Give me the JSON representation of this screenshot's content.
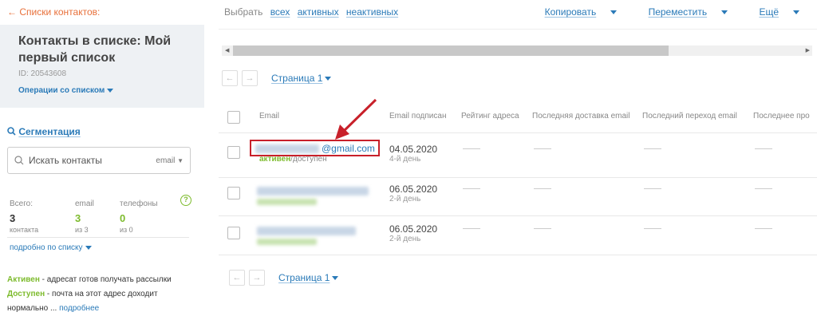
{
  "sidebar": {
    "back_link": "← Списки контактов:",
    "list_title": "Контакты в списке: Мой первый список",
    "list_id": "ID: 20543608",
    "list_ops": "Операции со списком",
    "segmentation": "Сегментация",
    "search_placeholder": "Искать контакты",
    "search_filter": "email",
    "stats": {
      "total_label": "Всего:",
      "email_label": "email",
      "phones_label": "телефоны",
      "total_value": "3",
      "email_value": "3",
      "phones_value": "0",
      "total_sub": "контакта",
      "email_sub": "из 3",
      "phones_sub": "из 0",
      "help": "?"
    },
    "detail_link": "подробно по списку",
    "legend": {
      "active": "Активен",
      "active_text": " - адресат готов получать рассылки",
      "available": "Доступен",
      "available_text": " - почта на этот адрес доходит",
      "more_prefix": "нормально ... ",
      "more_link": "подробнее"
    }
  },
  "toolbar": {
    "select_label": "Выбрать",
    "select_all": "всех",
    "select_active": "активных",
    "select_inactive": "неактивных",
    "copy": "Копировать",
    "move": "Переместить",
    "more": "Ещё"
  },
  "pager": {
    "prev": "←",
    "next": "→",
    "page_label": "Страница 1"
  },
  "table": {
    "headers": [
      "Email",
      "Email подписан",
      "Рейтинг адреса",
      "Последняя доставка email",
      "Последний переход email",
      "Последнее про"
    ],
    "rows": [
      {
        "email_visible": "@gmail.com",
        "status_active": "активен",
        "status_rest": "/доступен",
        "date": "04.05.2020",
        "day": "4-й день"
      },
      {
        "date": "06.05.2020",
        "day": "2-й день"
      },
      {
        "date": "06.05.2020",
        "day": "2-й день"
      }
    ]
  },
  "colors": {
    "accent": "#2a7ab8",
    "back": "#e8703a",
    "green": "#7dbb2d",
    "highlight": "#c8202a"
  }
}
